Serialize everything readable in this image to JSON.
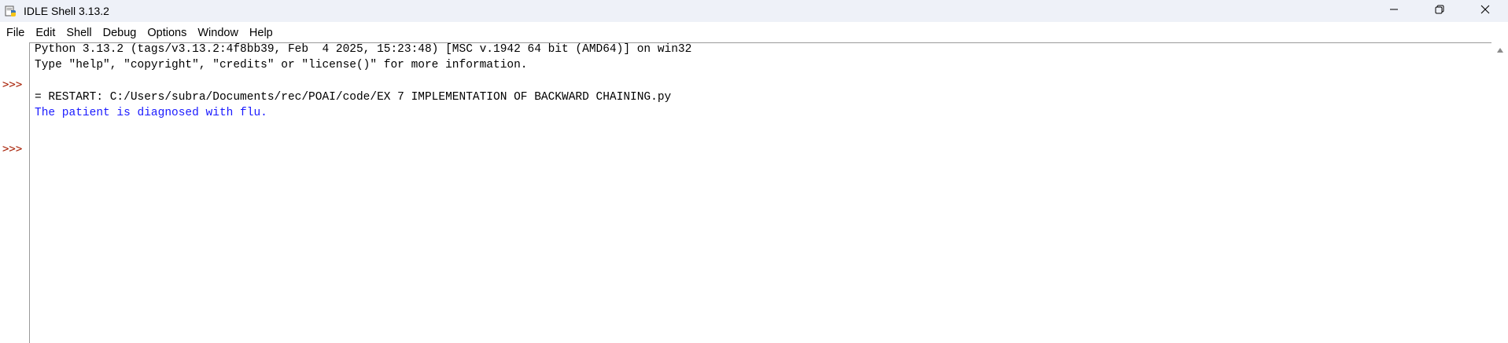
{
  "window": {
    "title": "IDLE Shell 3.13.2",
    "icon": "python-idle-icon",
    "controls": {
      "minimize": "minimize-icon",
      "maximize": "restore-icon",
      "close": "close-icon"
    }
  },
  "menubar": {
    "items": [
      "File",
      "Edit",
      "Shell",
      "Debug",
      "Options",
      "Window",
      "Help"
    ]
  },
  "shell": {
    "prompt": ">>>",
    "lines": [
      {
        "text": "Python 3.13.2 (tags/v3.13.2:4f8bb39, Feb  4 2025, 15:23:48) [MSC v.1942 64 bit (AMD64)] on win32",
        "kind": "banner"
      },
      {
        "text": "Type \"help\", \"copyright\", \"credits\" or \"license()\" for more information.",
        "kind": "banner"
      },
      {
        "text": "",
        "kind": "prompt-line"
      },
      {
        "text": "= RESTART: C:/Users/subra/Documents/rec/POAI/code/EX 7 IMPLEMENTATION OF BACKWARD CHAINING.py",
        "kind": "restart"
      },
      {
        "text": "The patient is diagnosed with flu.",
        "kind": "stdout"
      },
      {
        "text": "",
        "kind": "prompt-line"
      }
    ]
  },
  "colors": {
    "prompt": "#a61c00",
    "stdout": "#1a1aff",
    "text": "#000000",
    "titlebar": "#eef1f8"
  }
}
